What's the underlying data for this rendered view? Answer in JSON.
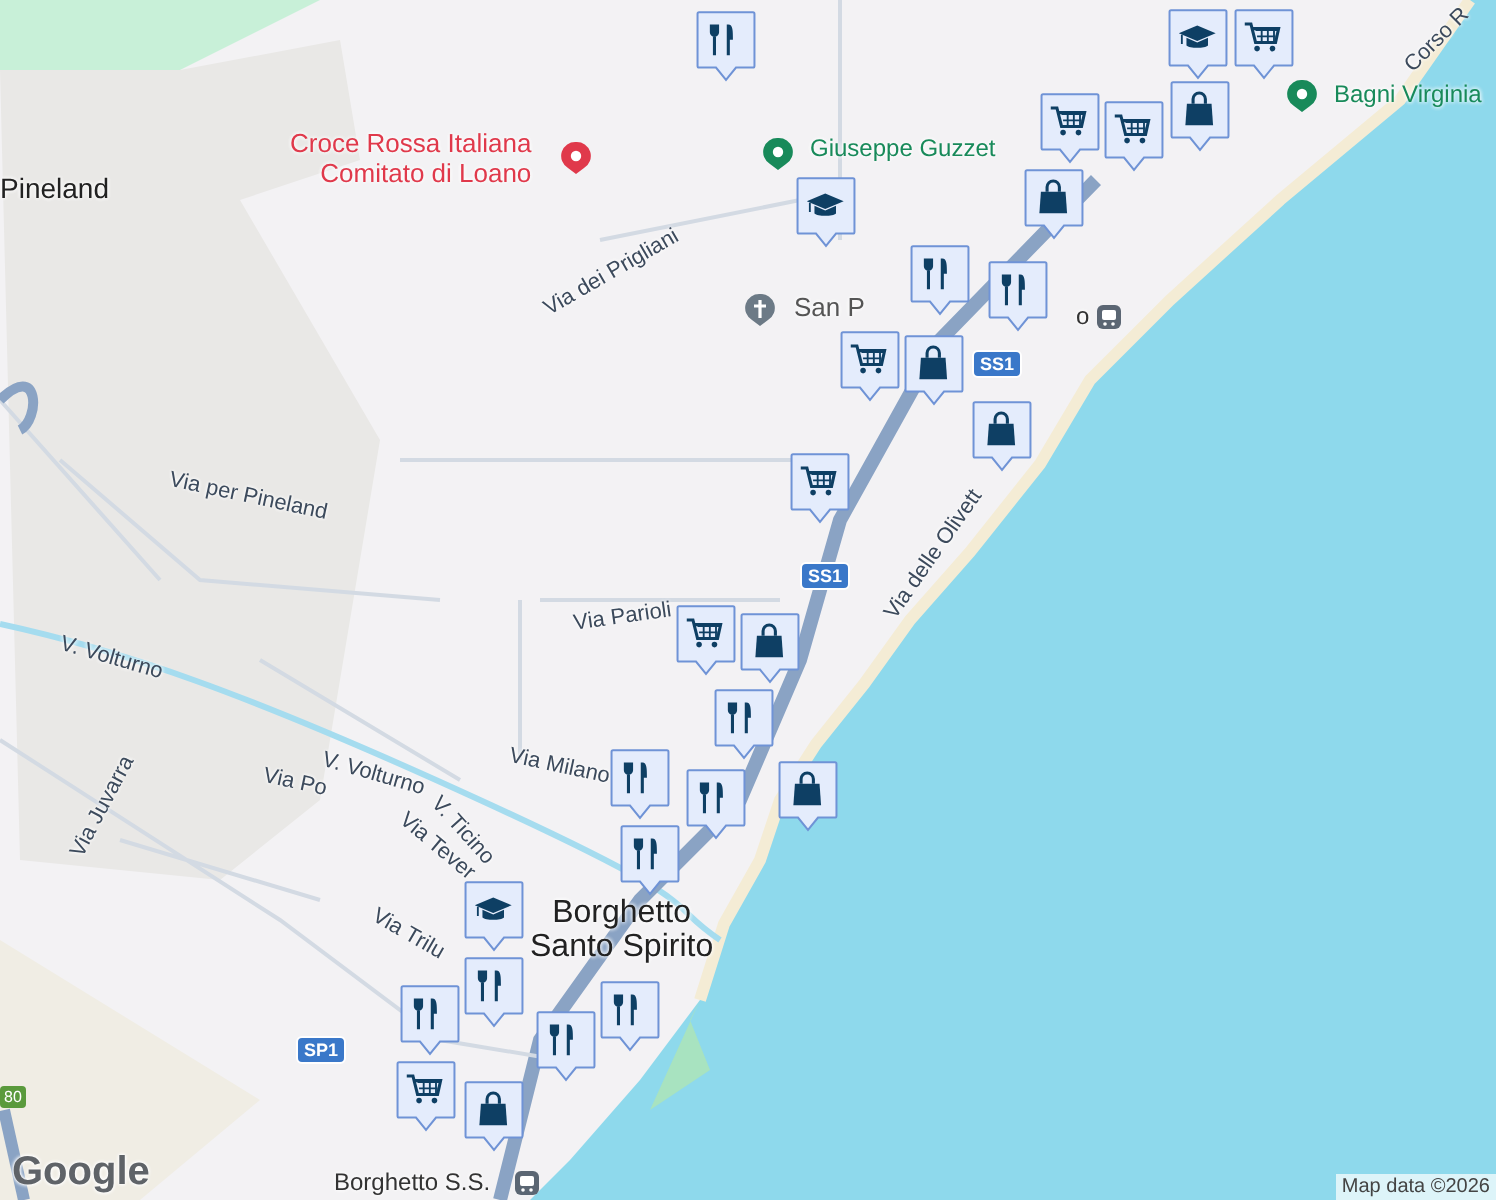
{
  "map": {
    "labels": [
      {
        "text": "Pineland",
        "kind": "area"
      },
      {
        "text": "Croce Rossa Italiana\nComitato di Loano",
        "kind": "poi-red"
      },
      {
        "text": "Giuseppe Guzzet",
        "kind": "poi-green"
      },
      {
        "text": "Bagni Virginia",
        "kind": "poi-green"
      },
      {
        "text": "Corso R",
        "kind": "street"
      },
      {
        "text": "Via dei Prigliani",
        "kind": "street"
      },
      {
        "text": "San P",
        "kind": "poi-grey"
      },
      {
        "text": "o",
        "kind": "station"
      },
      {
        "text": "Via per Pineland",
        "kind": "street"
      },
      {
        "text": "Via Parioli",
        "kind": "street"
      },
      {
        "text": "SS1",
        "kind": "shield"
      },
      {
        "text": "SS1",
        "kind": "shield"
      },
      {
        "text": "Via delle Olivett",
        "kind": "street"
      },
      {
        "text": "V. Volturno",
        "kind": "street"
      },
      {
        "text": "V. Volturno",
        "kind": "street"
      },
      {
        "text": "Via Milano",
        "kind": "street"
      },
      {
        "text": "Via Po",
        "kind": "street"
      },
      {
        "text": "V. Ticino",
        "kind": "street"
      },
      {
        "text": "Via Tever",
        "kind": "street"
      },
      {
        "text": "Via Juvarra",
        "kind": "street"
      },
      {
        "text": "Via Trilu",
        "kind": "street"
      },
      {
        "text": "Borghetto\nSanto Spirito",
        "kind": "city"
      },
      {
        "text": "SP1",
        "kind": "shield"
      },
      {
        "text": "Borghetto S.S.",
        "kind": "station"
      },
      {
        "text": "80",
        "kind": "shield-green"
      }
    ],
    "markers": [
      {
        "kind": "restaurant"
      },
      {
        "kind": "school"
      },
      {
        "kind": "cart"
      },
      {
        "kind": "cart"
      },
      {
        "kind": "shop"
      },
      {
        "kind": "cart"
      },
      {
        "kind": "shop"
      },
      {
        "kind": "school"
      },
      {
        "kind": "restaurant"
      },
      {
        "kind": "restaurant"
      },
      {
        "kind": "cart"
      },
      {
        "kind": "shop"
      },
      {
        "kind": "cart"
      },
      {
        "kind": "shop"
      },
      {
        "kind": "cart"
      },
      {
        "kind": "shop"
      },
      {
        "kind": "restaurant"
      },
      {
        "kind": "restaurant"
      },
      {
        "kind": "restaurant"
      },
      {
        "kind": "restaurant"
      },
      {
        "kind": "shop"
      },
      {
        "kind": "school"
      },
      {
        "kind": "restaurant"
      },
      {
        "kind": "restaurant"
      },
      {
        "kind": "cart"
      },
      {
        "kind": "restaurant"
      },
      {
        "kind": "restaurant"
      },
      {
        "kind": "shop"
      }
    ],
    "logo": "Google",
    "attribution": "Map data ©2026"
  }
}
